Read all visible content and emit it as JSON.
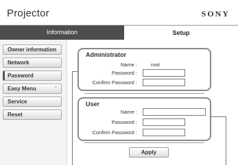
{
  "header": {
    "title": "Projector",
    "brand": "SONY"
  },
  "tabs": [
    {
      "label": "Information",
      "active": false
    },
    {
      "label": "Setup",
      "active": true
    }
  ],
  "sidebar": {
    "items": [
      {
        "label": "Owner information"
      },
      {
        "label": "Network"
      },
      {
        "label": "Password",
        "active": true
      },
      {
        "label": "Easy Menu",
        "icon": "chevron-up-icon"
      },
      {
        "label": "Service"
      },
      {
        "label": "Reset"
      }
    ]
  },
  "administrator": {
    "title": "Administrator",
    "name_label": "Name :",
    "name_value": "root",
    "password_label": "Password :",
    "password_value": "",
    "confirm_label": "Confirm Password :",
    "confirm_value": ""
  },
  "user": {
    "title": "User",
    "name_label": "Name :",
    "name_value": "",
    "password_label": "Password :",
    "password_value": "",
    "confirm_label": "Confirm Password :",
    "confirm_value": ""
  },
  "apply_label": "Apply"
}
